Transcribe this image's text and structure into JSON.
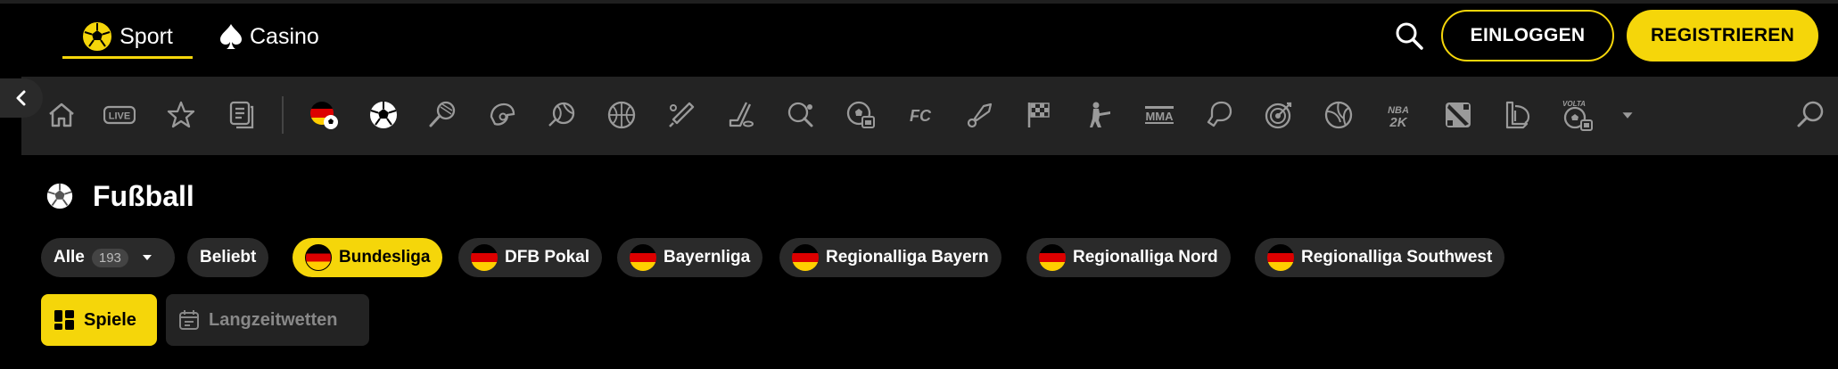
{
  "topnav": {
    "sport_label": "Sport",
    "casino_label": "Casino",
    "login_label": "EINLOGGEN",
    "register_label": "REGISTRIEREN"
  },
  "colors": {
    "accent": "#f5d60a",
    "background": "#000000",
    "bar": "#232323",
    "chip": "#2a2a2a"
  },
  "sports_icons": [
    "home-icon",
    "live-icon",
    "star-icon",
    "betslip-icon",
    "germany-football-icon",
    "football-icon",
    "tennis-icon",
    "american-football-icon",
    "volleyball-icon",
    "basketball-icon",
    "cricket-icon",
    "ice-hockey-icon",
    "table-tennis-icon",
    "esports-football-icon",
    "fc-icon",
    "badminton-icon",
    "motorsport-icon",
    "counter-strike-icon",
    "mma-icon",
    "boxing-icon",
    "darts-icon",
    "volleyball-ball-icon",
    "nba2k-icon",
    "dota-icon",
    "lol-icon",
    "volta-icon",
    "more-chevron-icon",
    "sports-search-icon"
  ],
  "sports_text_icons": {
    "live": "LIVE",
    "fc": "FC",
    "mma": "MMA",
    "nba2k_top": "NBA",
    "nba2k_bottom": "2K",
    "volta": "VOLTA"
  },
  "page": {
    "title": "Fußball"
  },
  "filters": {
    "all_label": "Alle",
    "all_count": "193",
    "chips": [
      {
        "label": "Beliebt",
        "flag": false,
        "active": false
      },
      {
        "label": "Bundesliga",
        "flag": true,
        "active": true
      },
      {
        "label": "DFB Pokal",
        "flag": true,
        "active": false
      },
      {
        "label": "Bayernliga",
        "flag": true,
        "active": false
      },
      {
        "label": "Regionalliga Bayern",
        "flag": true,
        "active": false
      },
      {
        "label": "Regionalliga Nord",
        "flag": true,
        "active": false
      },
      {
        "label": "Regionalliga Southwest",
        "flag": true,
        "active": false
      }
    ]
  },
  "views": {
    "games_label": "Spiele",
    "outrights_label": "Langzeitwetten"
  }
}
